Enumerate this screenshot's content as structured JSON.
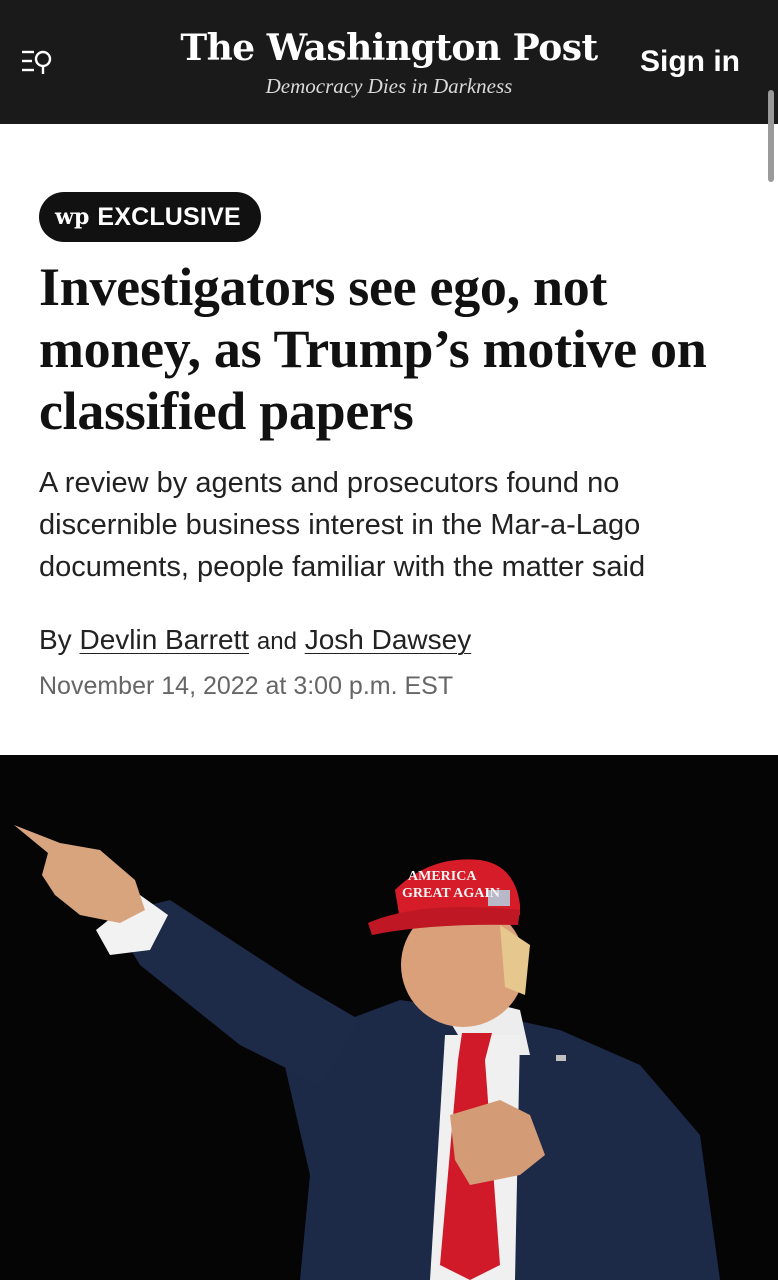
{
  "header": {
    "menu_icon": "menu-search-icon",
    "brand_name": "The Washington Post",
    "tagline": "Democracy Dies in Darkness",
    "sign_in_label": "Sign in",
    "background_color": "#1a1a1a"
  },
  "article": {
    "badge": {
      "logo_text": "wp",
      "label": "EXCLUSIVE"
    },
    "headline": "Investigators see ego, not money, as Trump’s motive on classified papers",
    "dek": "A review by agents and prosecutors found no discernible business interest in the Mar-a-Lago documents, people familiar with the matter said",
    "byline": {
      "prefix": "By",
      "conjunction": "and",
      "authors": [
        "Devlin Barrett",
        "Josh Dawsey"
      ]
    },
    "timestamp": "November 14, 2022 at 3:00 p.m. EST"
  },
  "photo": {
    "hat_text_line1": "AMERICA",
    "hat_text_line2": "GREAT AGAIN"
  }
}
